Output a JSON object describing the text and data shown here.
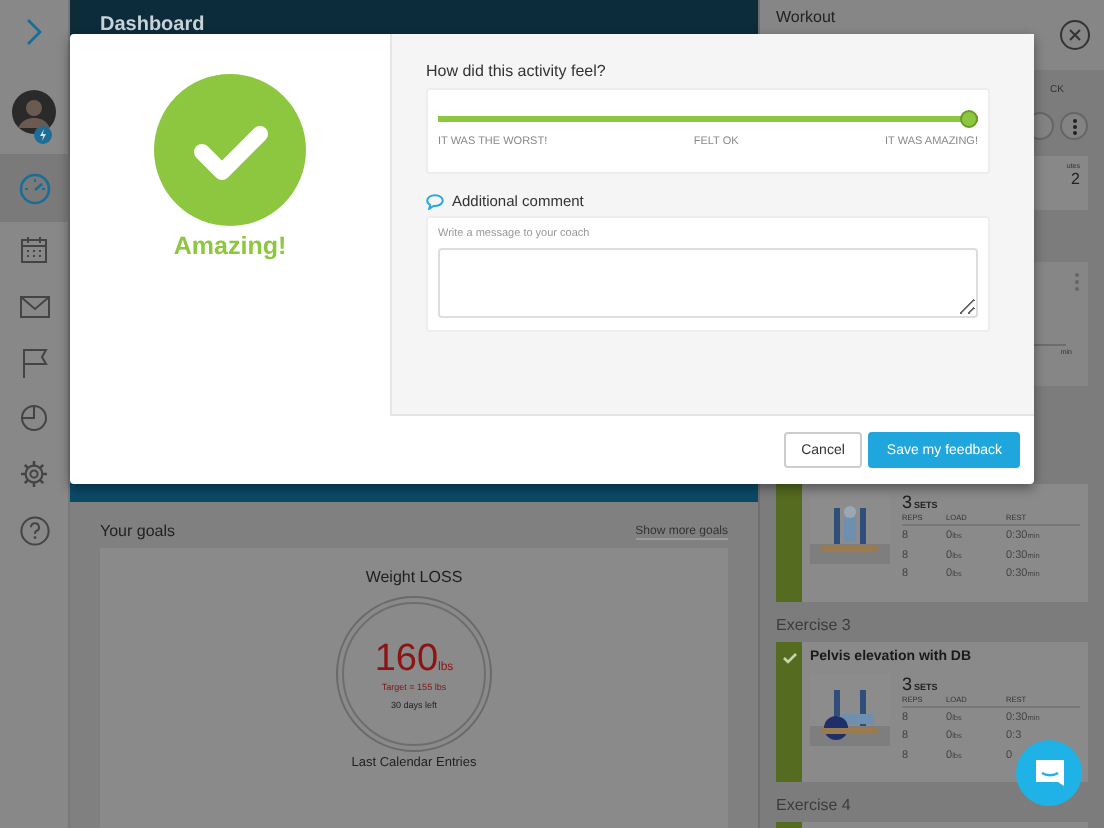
{
  "sidebar": {
    "items": [
      {
        "selected": false
      },
      {
        "selected": true
      },
      {
        "selected": false
      },
      {
        "selected": false
      },
      {
        "selected": false
      },
      {
        "selected": false
      },
      {
        "selected": false
      },
      {
        "selected": false
      }
    ]
  },
  "dashboard": {
    "title": "Dashboard",
    "goals": {
      "title": "Your goals",
      "link": "Show more goals",
      "goal": {
        "name": "Weight LOSS",
        "value": "160",
        "unit": "lbs",
        "target": "Target = 155 lbs",
        "remaining": "30 days left"
      },
      "next_section": "Last Calendar Entries"
    }
  },
  "workout": {
    "title": "Workout",
    "header_fragment": "CK",
    "stat_label": "utes",
    "stat_value": "2",
    "card_fragment": "min",
    "exercises": [
      {
        "sets": "3",
        "sets_unit": "SETS",
        "columns": [
          "REPS",
          "LOAD",
          "REST"
        ],
        "rows": [
          {
            "reps": "8",
            "load": "0",
            "load_unit": "lbs",
            "rest": "0:30",
            "rest_unit": "min"
          },
          {
            "reps": "8",
            "load": "0",
            "load_unit": "lbs",
            "rest": "0:30",
            "rest_unit": "min"
          },
          {
            "reps": "8",
            "load": "0",
            "load_unit": "lbs",
            "rest": "0:30",
            "rest_unit": "min"
          }
        ]
      },
      {
        "label": "Exercise 3",
        "done": true,
        "name": "Pelvis elevation with DB",
        "sets": "3",
        "sets_unit": "SETS",
        "columns": [
          "REPS",
          "LOAD",
          "REST"
        ],
        "rows": [
          {
            "reps": "8",
            "load": "0",
            "load_unit": "lbs",
            "rest": "0:30",
            "rest_unit": "min"
          },
          {
            "reps": "8",
            "load": "0",
            "load_unit": "lbs",
            "rest": "0:3"
          },
          {
            "reps": "8",
            "load": "0",
            "load_unit": "lbs",
            "rest": "0"
          }
        ]
      },
      {
        "label": "Exercise 4"
      }
    ]
  },
  "feedback": {
    "result": "Amazing!",
    "question": "How did this activity feel?",
    "slider": {
      "level": 1,
      "labels": [
        "IT WAS THE WORST!",
        "FELT OK",
        "IT WAS AMAZING!"
      ]
    },
    "comment_label": "Additional comment",
    "comment_hint": "Write a message to your coach",
    "buttons": [
      {
        "label": "Cancel",
        "kind": "secondary"
      },
      {
        "label": "Save my feedback",
        "kind": "primary"
      }
    ]
  }
}
